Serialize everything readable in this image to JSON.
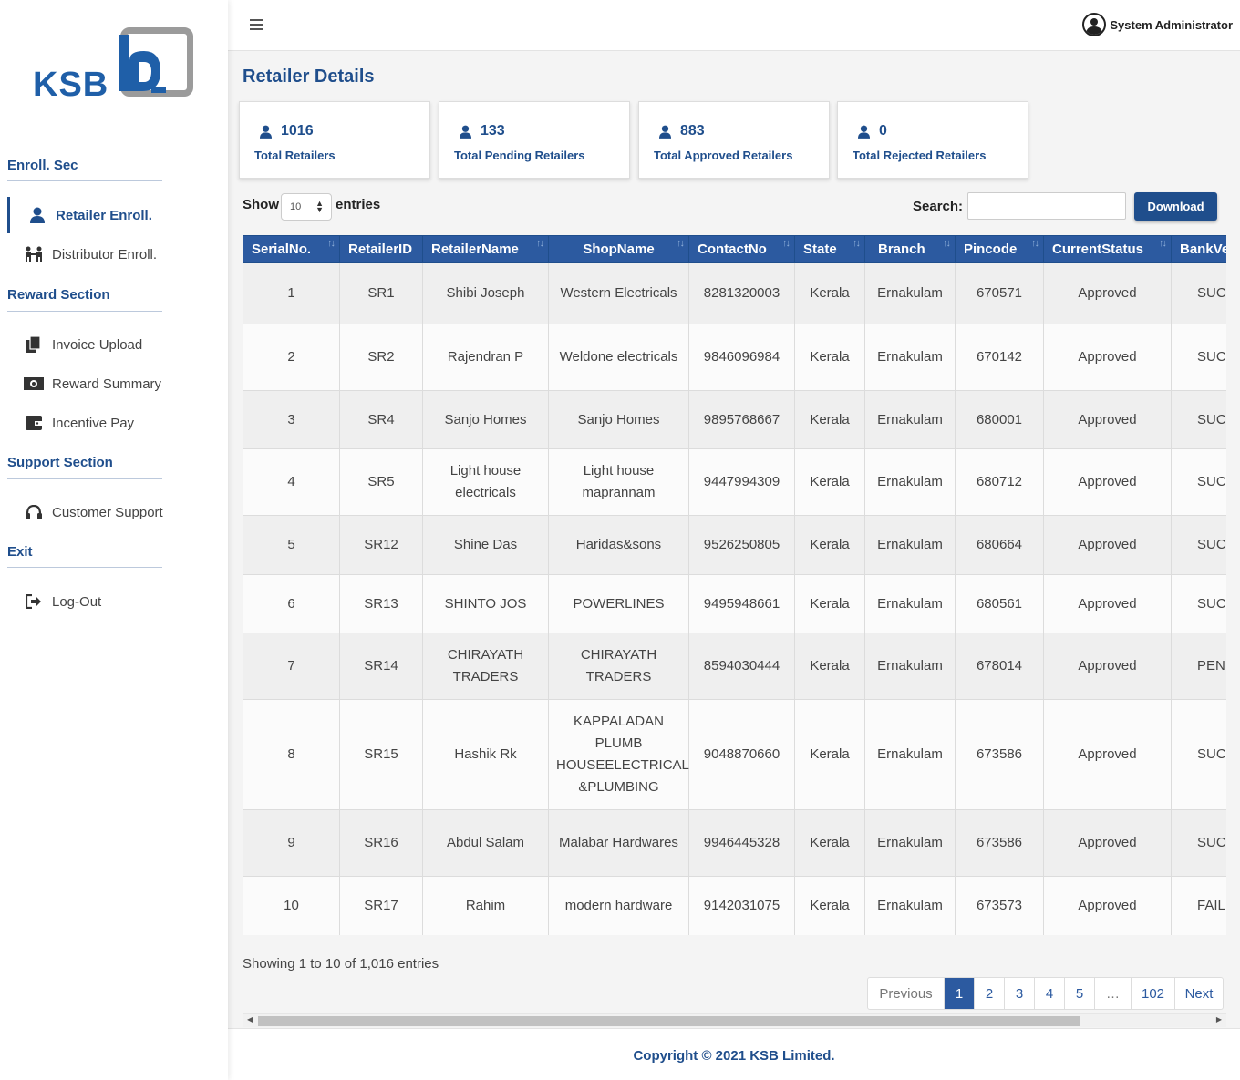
{
  "brand": {
    "logo_text": "KSB",
    "accent": "#1f4e8c",
    "header_bg": "#2c5aa0"
  },
  "user": {
    "name": "System Administrator",
    "icon": "user-circle-icon"
  },
  "sidebar": {
    "sections": [
      {
        "title": "Enroll. Sec",
        "items": [
          {
            "label": "Retailer Enroll.",
            "icon": "user-icon",
            "active": true
          },
          {
            "label": "Distributor Enroll.",
            "icon": "people-icon"
          }
        ]
      },
      {
        "title": "Reward Section",
        "items": [
          {
            "label": "Invoice Upload",
            "icon": "files-icon"
          },
          {
            "label": "Reward Summary",
            "icon": "money-icon"
          },
          {
            "label": "Incentive Pay",
            "icon": "wallet-icon"
          }
        ]
      },
      {
        "title": "Support Section",
        "items": [
          {
            "label": "Customer Support",
            "icon": "headset-icon"
          }
        ]
      },
      {
        "title": "Exit",
        "items": [
          {
            "label": "Log-Out",
            "icon": "logout-icon"
          }
        ]
      }
    ]
  },
  "page": {
    "title": "Retailer Details"
  },
  "stats": [
    {
      "value": "1016",
      "label": "Total Retailers"
    },
    {
      "value": "133",
      "label": "Total Pending Retailers"
    },
    {
      "value": "883",
      "label": "Total Approved Retailers"
    },
    {
      "value": "0",
      "label": "Total Rejected Retailers"
    }
  ],
  "controls": {
    "show_label": "Show",
    "entries_value": "10",
    "entries_label": "entries",
    "search_label": "Search:",
    "search_value": "",
    "download_label": "Download"
  },
  "table": {
    "columns": [
      "SerialNo.",
      "RetailerID",
      "RetailerName",
      "ShopName",
      "ContactNo",
      "State",
      "Branch",
      "Pincode",
      "CurrentStatus",
      "BankVe"
    ],
    "rows": [
      [
        "1",
        "SR1",
        "Shibi Joseph",
        "Western Electricals",
        "8281320003",
        "Kerala",
        "Ernakulam",
        "670571",
        "Approved",
        "SUCC"
      ],
      [
        "2",
        "SR2",
        "Rajendran P",
        "Weldone electricals",
        "9846096984",
        "Kerala",
        "Ernakulam",
        "670142",
        "Approved",
        "SUCC"
      ],
      [
        "3",
        "SR4",
        "Sanjo Homes",
        "Sanjo Homes",
        "9895768667",
        "Kerala",
        "Ernakulam",
        "680001",
        "Approved",
        "SUCC"
      ],
      [
        "4",
        "SR5",
        "Light house electricals",
        "Light house maprannam",
        "9447994309",
        "Kerala",
        "Ernakulam",
        "680712",
        "Approved",
        "SUCC"
      ],
      [
        "5",
        "SR12",
        "Shine Das",
        "Haridas&sons",
        "9526250805",
        "Kerala",
        "Ernakulam",
        "680664",
        "Approved",
        "SUCC"
      ],
      [
        "6",
        "SR13",
        "SHINTO JOS",
        "POWERLINES",
        "9495948661",
        "Kerala",
        "Ernakulam",
        "680561",
        "Approved",
        "SUCC"
      ],
      [
        "7",
        "SR14",
        "CHIRAYATH TRADERS",
        "CHIRAYATH TRADERS",
        "8594030444",
        "Kerala",
        "Ernakulam",
        "678014",
        "Approved",
        "PEND"
      ],
      [
        "8",
        "SR15",
        "Hashik Rk",
        "KAPPALADAN PLUMB HOUSEELECTRICAL &PLUMBING",
        "9048870660",
        "Kerala",
        "Ernakulam",
        "673586",
        "Approved",
        "SUCC"
      ],
      [
        "9",
        "SR16",
        "Abdul Salam",
        "Malabar Hardwares",
        "9946445328",
        "Kerala",
        "Ernakulam",
        "673586",
        "Approved",
        "SUCC"
      ],
      [
        "10",
        "SR17",
        "Rahim",
        "modern hardware",
        "9142031075",
        "Kerala",
        "Ernakulam",
        "673573",
        "Approved",
        "FAIL"
      ]
    ]
  },
  "info": "Showing 1 to 10 of 1,016 entries",
  "pagination": [
    "Previous",
    "1",
    "2",
    "3",
    "4",
    "5",
    "…",
    "102",
    "Next"
  ],
  "pagination_active": "1",
  "footer": "Copyright © 2021 KSB Limited."
}
